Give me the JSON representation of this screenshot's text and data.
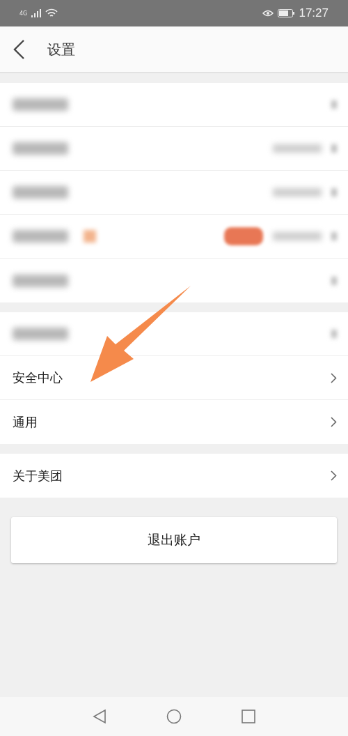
{
  "status_bar": {
    "network": "4G",
    "time": "17:27"
  },
  "header": {
    "title": "设置"
  },
  "sections": [
    {
      "rows": [
        {
          "kind": "blurred",
          "redacted_value": false,
          "redacted_tag": false,
          "redacted_pill": false
        },
        {
          "kind": "blurred",
          "redacted_value": true,
          "redacted_tag": false,
          "redacted_pill": false
        },
        {
          "kind": "blurred",
          "redacted_value": true,
          "redacted_tag": false,
          "redacted_pill": false
        },
        {
          "kind": "blurred",
          "redacted_value": true,
          "redacted_tag": true,
          "redacted_pill": true
        },
        {
          "kind": "blurred",
          "redacted_value": false,
          "redacted_tag": false,
          "redacted_pill": false
        }
      ]
    },
    {
      "rows": [
        {
          "kind": "blurred",
          "redacted_value": false,
          "redacted_tag": false,
          "redacted_pill": false
        },
        {
          "kind": "item",
          "label": "安全中心"
        },
        {
          "kind": "item",
          "label": "通用"
        }
      ]
    },
    {
      "rows": [
        {
          "kind": "item",
          "label": "关于美团"
        }
      ]
    }
  ],
  "logout_button": "退出账户"
}
